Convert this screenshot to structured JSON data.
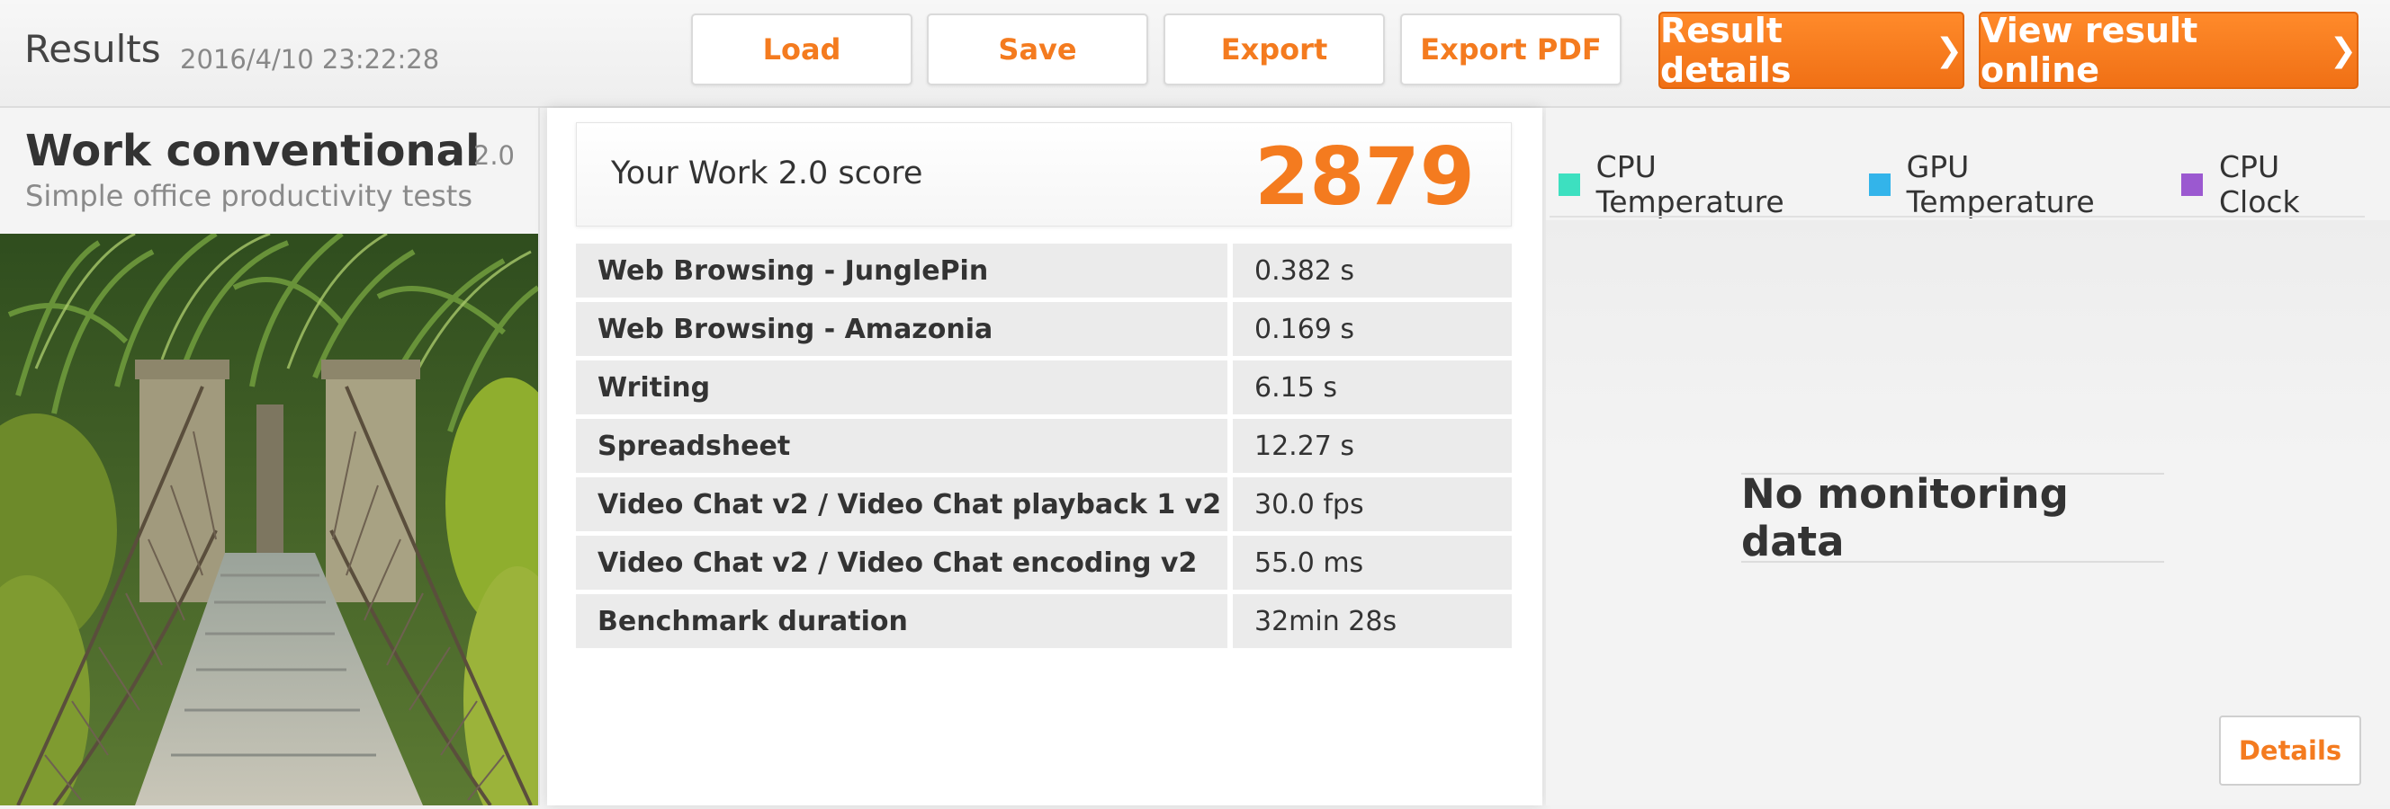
{
  "header": {
    "title": "Results",
    "timestamp": "2016/4/10 23:22:28",
    "buttons": {
      "load": "Load",
      "save": "Save",
      "export": "Export",
      "export_pdf": "Export PDF",
      "result_details": "Result details",
      "view_online": "View result online",
      "chevron": "❯"
    }
  },
  "test": {
    "name": "Work conventional",
    "version": "2.0",
    "description": "Simple office productivity tests",
    "image_icon": "rope-bridge-jungle-photo"
  },
  "score": {
    "label": "Your Work 2.0 score",
    "value": "2879"
  },
  "results": [
    {
      "name": "Web Browsing - JunglePin",
      "value": "0.382 s"
    },
    {
      "name": "Web Browsing - Amazonia",
      "value": "0.169 s"
    },
    {
      "name": "Writing",
      "value": "6.15 s"
    },
    {
      "name": "Spreadsheet",
      "value": "12.27 s"
    },
    {
      "name": "Video Chat v2 / Video Chat playback 1 v2",
      "value": "30.0 fps"
    },
    {
      "name": "Video Chat v2 / Video Chat encoding v2",
      "value": "55.0 ms"
    },
    {
      "name": "Benchmark duration",
      "value": "32min 28s"
    }
  ],
  "monitoring": {
    "legend": [
      {
        "label": "CPU Temperature",
        "color": "#3de0c0"
      },
      {
        "label": "GPU Temperature",
        "color": "#33b4ea"
      },
      {
        "label": "CPU Clock",
        "color": "#9b59d0"
      }
    ],
    "empty_message": "No monitoring data",
    "details_label": "Details"
  },
  "colors": {
    "accent": "#f47b1f"
  }
}
